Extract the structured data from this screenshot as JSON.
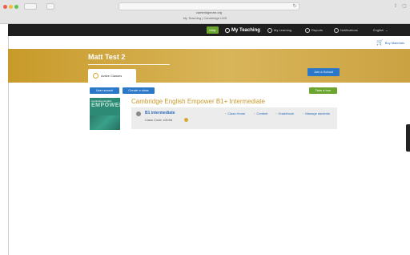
{
  "browser": {
    "url": "cambridgeone.org",
    "tab_title": "My Teaching | Cambridge LMS"
  },
  "navbar": {
    "help_label": "Help",
    "items": [
      {
        "label": "My Teaching",
        "icon": "teaching-icon",
        "active": true
      },
      {
        "label": "My Learning",
        "icon": "learning-icon",
        "active": false
      },
      {
        "label": "Reports",
        "icon": "reports-icon",
        "active": false
      },
      {
        "label": "Notifications",
        "icon": "bell-icon",
        "active": false
      },
      {
        "label": "English",
        "icon": "chevron-down-icon",
        "active": false
      }
    ]
  },
  "buy_materials": "Buy Materials",
  "banner": {
    "user_name": "Matt Test 2",
    "active_tab": "Active Classes",
    "join_school_label": "Join a School"
  },
  "actions": {
    "user_search": "User search",
    "create_class": "Create a class",
    "take_tour": "Take a tour"
  },
  "course": {
    "title": "Cambridge English Empower B1+ Intermediate",
    "cover_top": "Cambridge English",
    "cover_word": "EMPOWER",
    "class_name": "B1 intermediate",
    "class_code": "Class Code: e2b9d",
    "links": [
      "Class Home",
      "Content",
      "Gradebook",
      "Manage students"
    ]
  },
  "colors": {
    "navbar_bg": "#1f1f1f",
    "banner_gold": "#c89a2a",
    "primary_blue": "#2b78c9",
    "help_green": "#6aa62d"
  }
}
